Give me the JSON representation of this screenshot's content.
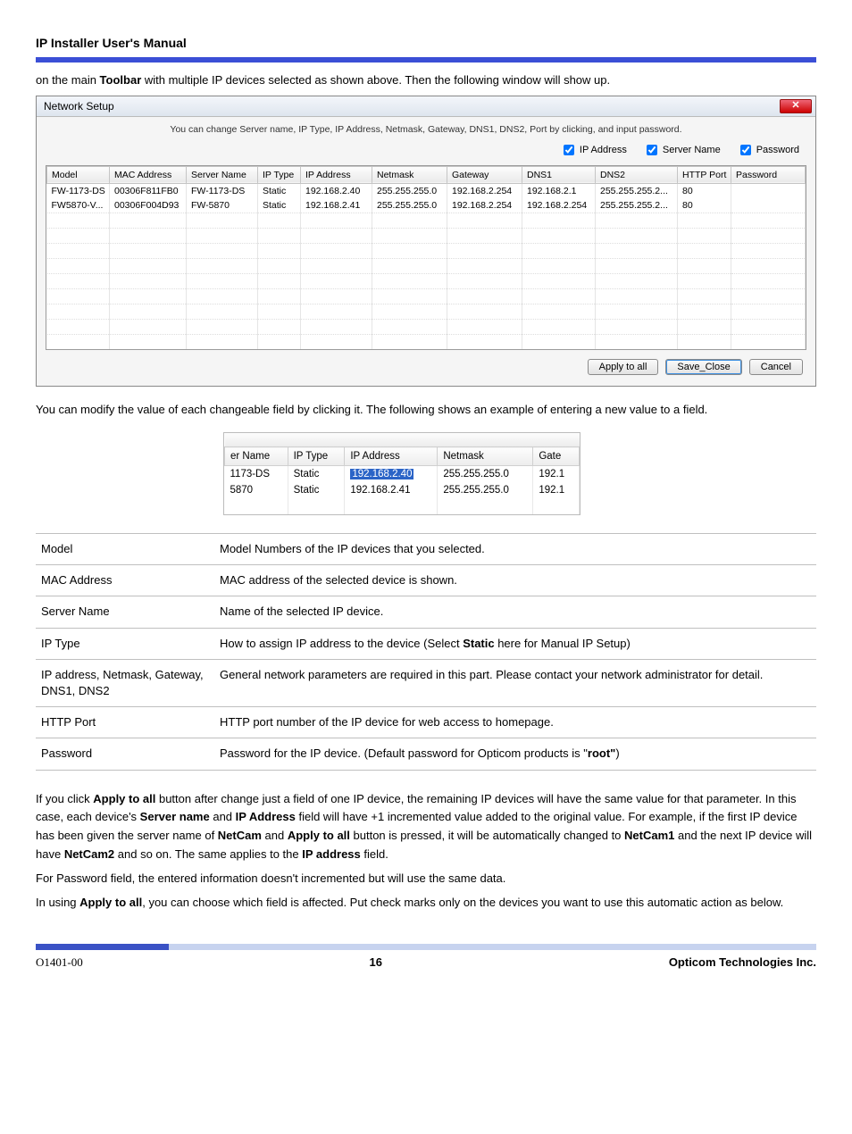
{
  "page_title": "IP Installer User's Manual",
  "intro_text_before_bold": "on the main ",
  "intro_bold": "Toolbar",
  "intro_text_after_bold": " with multiple IP devices selected as shown above. Then the following window will show up.",
  "dialog": {
    "title": "Network Setup",
    "close_glyph": "✕",
    "instruction": "You can change Server name, IP Type, IP Address, Netmask, Gateway, DNS1, DNS2, Port by clicking, and input password.",
    "checks": {
      "ip": "IP Address",
      "server": "Server Name",
      "password": "Password"
    },
    "headers": [
      "Model",
      "MAC Address",
      "Server Name",
      "IP Type",
      "IP Address",
      "Netmask",
      "Gateway",
      "DNS1",
      "DNS2",
      "HTTP Port",
      "Password"
    ],
    "rows": [
      {
        "model": "FW-1173-DS",
        "mac": "00306F811FB0",
        "server": "FW-1173-DS",
        "iptype": "Static",
        "ip": "192.168.2.40",
        "netmask": "255.255.255.0",
        "gateway": "192.168.2.254",
        "dns1": "192.168.2.1",
        "dns2": "255.255.255.2...",
        "port": "80",
        "password": ""
      },
      {
        "model": "FW5870-V...",
        "mac": "00306F004D93",
        "server": "FW-5870",
        "iptype": "Static",
        "ip": "192.168.2.41",
        "netmask": "255.255.255.0",
        "gateway": "192.168.2.254",
        "dns1": "192.168.2.254",
        "dns2": "255.255.255.2...",
        "port": "80",
        "password": ""
      }
    ],
    "buttons": {
      "apply": "Apply to all",
      "save": "Save_Close",
      "cancel": "Cancel"
    }
  },
  "explain_1": "You can modify the value of each changeable field by clicking it. The following shows an example of entering a new value to a field.",
  "fragment": {
    "headers": [
      "er Name",
      "IP Type",
      "IP Address",
      "Netmask",
      "Gate"
    ],
    "rows": [
      {
        "name": "1173-DS",
        "iptype": "Static",
        "ip": "192.168.2.40",
        "netmask": "255.255.255.0",
        "gate": "192.1",
        "editing": true
      },
      {
        "name": "5870",
        "iptype": "Static",
        "ip": "192.168.2.41",
        "netmask": "255.255.255.0",
        "gate": "192.1",
        "editing": false
      }
    ]
  },
  "defs": [
    {
      "term": "Model",
      "desc_parts": [
        {
          "t": "Model Numbers of the IP devices that you selected."
        }
      ]
    },
    {
      "term": "MAC Address",
      "desc_parts": [
        {
          "t": "MAC address of the selected device is shown."
        }
      ]
    },
    {
      "term": "Server Name",
      "desc_parts": [
        {
          "t": "Name of the selected IP device."
        }
      ]
    },
    {
      "term": "IP Type",
      "desc_parts": [
        {
          "t": "How to assign IP address to the device (Select "
        },
        {
          "t": "Static",
          "b": true
        },
        {
          "t": " here for Manual IP Setup)"
        }
      ]
    },
    {
      "term": "IP address, Netmask, Gateway, DNS1, DNS2",
      "desc_parts": [
        {
          "t": "General network parameters are required in this part. Please contact your network administrator for detail."
        }
      ]
    },
    {
      "term": "HTTP Port",
      "desc_parts": [
        {
          "t": "HTTP port number of the IP device for web access to homepage."
        }
      ]
    },
    {
      "term": "Password",
      "desc_parts": [
        {
          "t": "Password for the IP device. (Default password for Opticom products is \""
        },
        {
          "t": "root\"",
          "b": true
        },
        {
          "t": ")"
        }
      ]
    }
  ],
  "para2_parts": [
    {
      "t": "If you click "
    },
    {
      "t": "Apply to all",
      "b": true
    },
    {
      "t": " button after change just a field of one IP device, the remaining IP devices will have the same value for that parameter. In this case, each device's "
    },
    {
      "t": "Server name",
      "b": true
    },
    {
      "t": " and "
    },
    {
      "t": "IP Address",
      "b": true
    },
    {
      "t": " field will have +1 incremented value added to the original value. For example, if the first IP device has been given the server name of "
    },
    {
      "t": "NetCam",
      "b": true
    },
    {
      "t": " and "
    },
    {
      "t": "Apply to all",
      "b": true
    },
    {
      "t": " button is pressed, it will be automatically changed to "
    },
    {
      "t": "NetCam1",
      "b": true
    },
    {
      "t": " and the next IP device will have "
    },
    {
      "t": "NetCam2",
      "b": true
    },
    {
      "t": " and so on. The same applies to the "
    },
    {
      "t": "IP address",
      "b": true
    },
    {
      "t": " field."
    }
  ],
  "para3": "For Password field, the entered information doesn't incremented but will use the same data.",
  "para4_parts": [
    {
      "t": "In using "
    },
    {
      "t": "Apply to all",
      "b": true
    },
    {
      "t": ", you can choose which field is affected. Put check marks only on the devices you want to use this automatic action as below."
    }
  ],
  "footer": {
    "left": "O1401-00",
    "center": "16",
    "right": "Opticom Technologies Inc."
  }
}
